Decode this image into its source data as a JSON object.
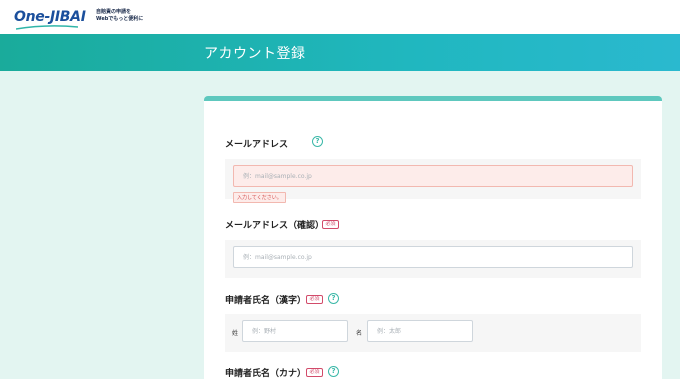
{
  "header": {
    "logo_text": "One-JIBAI",
    "tagline_line1": "自賠責の申請を",
    "tagline_line2": "Webでもっと便利に"
  },
  "page": {
    "title": "アカウント登録"
  },
  "form": {
    "required_label": "必須",
    "help_symbol": "?",
    "email": {
      "label": "メールアドレス",
      "placeholder": "例：mail@sample.co.jp",
      "error": "入力してください。"
    },
    "email_confirm": {
      "label": "メールアドレス（確認）",
      "placeholder": "例：mail@sample.co.jp"
    },
    "name_kanji": {
      "label": "申請者氏名（漢字）",
      "last_label": "姓",
      "last_placeholder": "例：野村",
      "first_label": "名",
      "first_placeholder": "例：太郎"
    },
    "name_kana": {
      "label": "申請者氏名（カナ）"
    }
  },
  "colors": {
    "brand": "#1b4f9c",
    "accent": "#20b7bf",
    "required": "#d24b6a",
    "error_bg": "#fdecea"
  }
}
